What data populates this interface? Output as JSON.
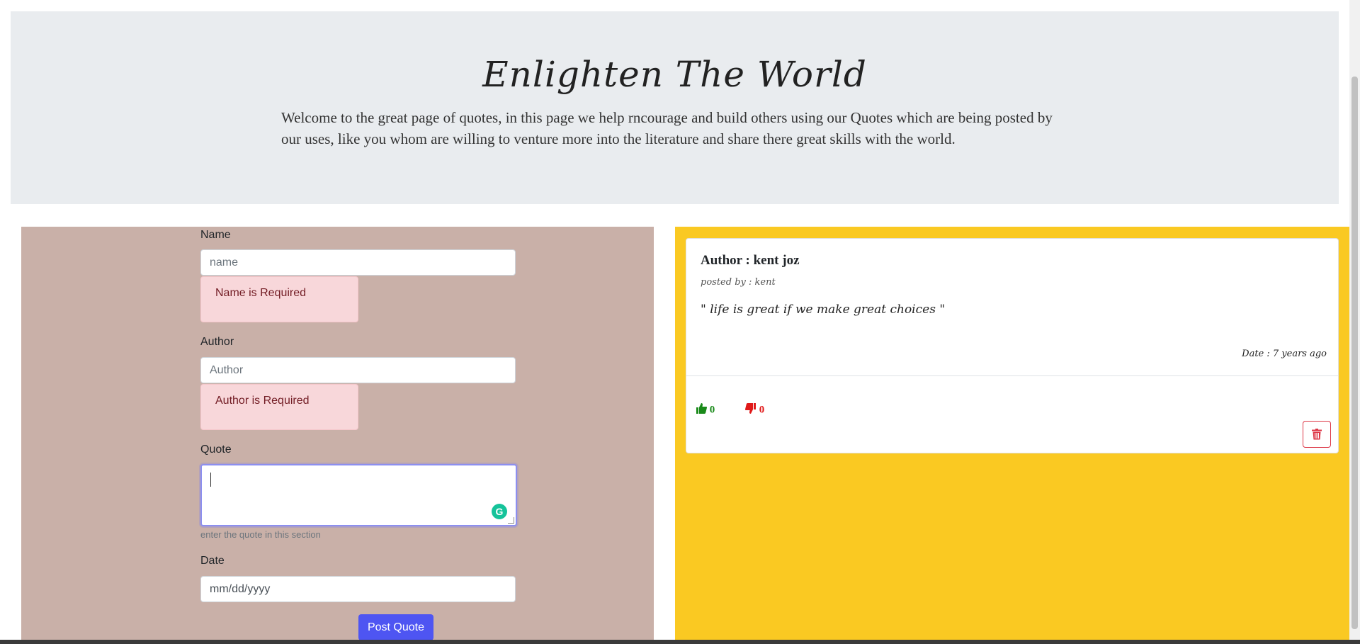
{
  "header": {
    "title": "Enlighten The World",
    "intro": "Welcome to the great page of quotes, in this page we help rncourage and build others using our Quotes which are being posted by our uses, like you whom are willing to venture more into the literature and share there great skills with the world."
  },
  "form": {
    "name_label": "Name",
    "name_placeholder": "name",
    "name_error": "Name is Required",
    "author_label": "Author",
    "author_placeholder": "Author",
    "author_error": "Author is Required",
    "quote_label": "Quote",
    "quote_help": "enter the quote in this section",
    "date_label": "Date",
    "date_placeholder": "mm/dd/yyyy",
    "submit_label": "Post Quote"
  },
  "quote_card": {
    "author": "Author : kent joz",
    "posted_by": "posted by : kent",
    "quote": "\" life is great if we make great choices \"",
    "date": "Date : 7 years ago",
    "upvotes": "0",
    "downvotes": "0"
  },
  "colors": {
    "form_panel": "#c9b0a8",
    "quote_panel": "#fac922",
    "submit": "#4e55f2",
    "upvote": "#1a8a1a",
    "downvote": "#e01919",
    "delete": "#dc3545"
  },
  "icons": {
    "upvote": "thumbs-up-icon",
    "downvote": "thumbs-down-icon",
    "delete": "trash-icon",
    "grammarly": "grammarly-icon"
  }
}
